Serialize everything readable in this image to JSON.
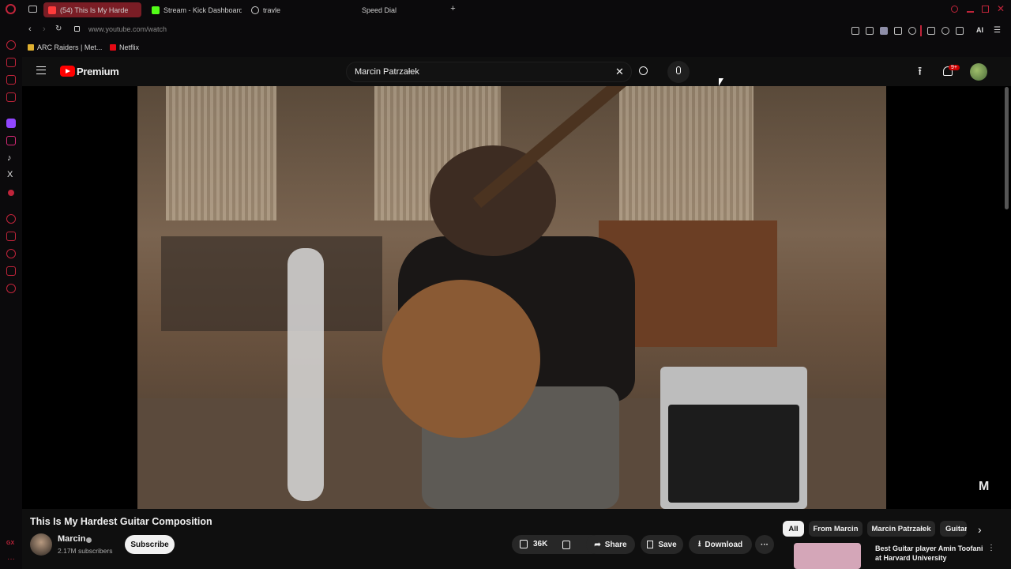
{
  "tabs": [
    {
      "label": "(54) This Is My Harde",
      "active": true
    },
    {
      "label": "Stream - Kick Dashboard",
      "active": false
    },
    {
      "label": "travle",
      "active": false
    },
    {
      "label": "Speed Dial",
      "active": false
    }
  ],
  "address": {
    "url": "www.youtube.com/watch"
  },
  "bookmarks": [
    {
      "label": "ARC Raiders | Met..."
    },
    {
      "label": "Netflix"
    }
  ],
  "toolbar": {
    "ai_label": "AI"
  },
  "youtube": {
    "brand": "Premium",
    "search_value": "Marcin Patrzałek",
    "notification_badge": "9+",
    "watermark": "M",
    "video_title": "This Is My Hardest Guitar Composition",
    "channel_name": "Marcin",
    "subscribers": "2.17M subscribers",
    "subscribe_label": "Subscribe",
    "like_count": "36K",
    "share_label": "Share",
    "save_label": "Save",
    "download_label": "Download",
    "chips": [
      "All",
      "From Marcin",
      "Marcin Patrzałek",
      "Guitar"
    ],
    "recommendation": {
      "title": "Best Guitar player Amin Toofani at Harvard University"
    }
  },
  "sidebar_corner_label": "GX",
  "colors": {
    "accent": "#c0243a",
    "yt_red": "#ff0000",
    "bg": "#0f0f0f"
  }
}
